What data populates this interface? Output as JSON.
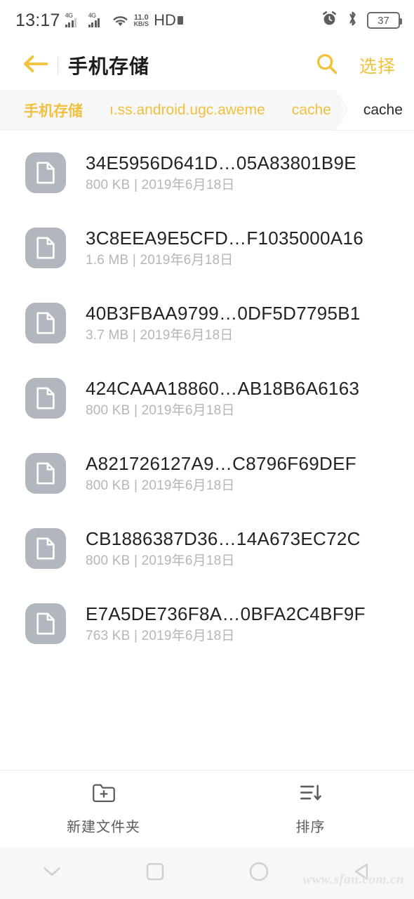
{
  "status_bar": {
    "time": "13:17",
    "network_label": "4G",
    "network_label_2": "4G",
    "data_rate_value": "11.0",
    "data_rate_unit": "KB/S",
    "hd_label": "HD",
    "battery_percent": "37",
    "icons": [
      "signal-4g-icon",
      "signal-4g-icon",
      "wifi-icon",
      "alarm-icon",
      "bluetooth-icon",
      "battery-icon"
    ]
  },
  "header": {
    "back_icon": "back-arrow-icon",
    "title": "手机存储",
    "search_icon": "search-icon",
    "select_label": "选择",
    "accent_color": "#f3c23c"
  },
  "breadcrumb": {
    "items": [
      {
        "label": "手机存储",
        "active": false
      },
      {
        "label": "ı.ss.android.ugc.aweme",
        "active": false
      },
      {
        "label": "cache",
        "active": false
      },
      {
        "label": "cache",
        "active": true
      }
    ]
  },
  "files": {
    "icon_name": "document-file-icon",
    "items": [
      {
        "name": "34E5956D641D…05A83801B9E",
        "info": "800 KB | 2019年6月18日"
      },
      {
        "name": "3C8EEA9E5CFD…F1035000A16",
        "info": "1.6 MB | 2019年6月18日"
      },
      {
        "name": "40B3FBAA9799…0DF5D7795B1",
        "info": "3.7 MB | 2019年6月18日"
      },
      {
        "name": "424CAAA18860…AB18B6A6163",
        "info": "800 KB | 2019年6月18日"
      },
      {
        "name": "A821726127A9…C8796F69DEF",
        "info": "800 KB | 2019年6月18日"
      },
      {
        "name": "CB1886387D36…14A673EC72C",
        "info": "800 KB | 2019年6月18日"
      },
      {
        "name": "E7A5DE736F8A…0BFA2C4BF9F",
        "info": "763 KB | 2019年6月18日"
      }
    ]
  },
  "toolbar": {
    "new_folder_label": "新建文件夹",
    "new_folder_icon": "folder-plus-icon",
    "sort_label": "排序",
    "sort_icon": "sort-descending-icon"
  },
  "navbar": {
    "icons": [
      "chevron-down-icon",
      "recents-square-icon",
      "home-circle-icon",
      "back-triangle-icon"
    ]
  },
  "watermark": {
    "text": "www.sfan.com.cn"
  }
}
